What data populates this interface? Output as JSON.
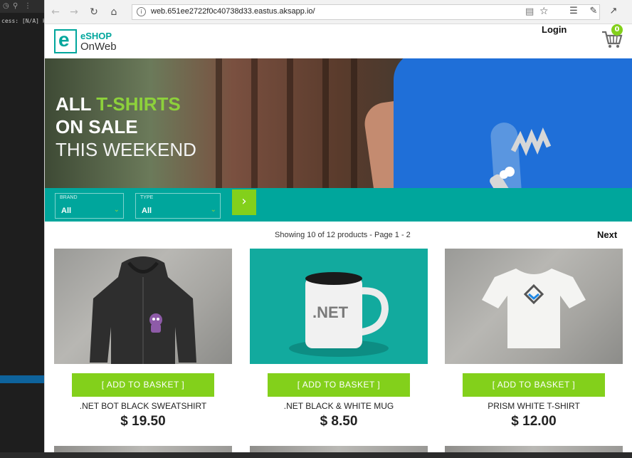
{
  "editor": {
    "access_text": "cess:  [N/A] ku",
    "tool_glyphs": [
      "◷",
      "⚲",
      "⋮"
    ]
  },
  "browser": {
    "url": "web.651ee2722f0c40738d33.eastus.aksapp.io/",
    "icons": {
      "back": "back-arrow-icon",
      "forward": "forward-arrow-icon",
      "refresh": "refresh-icon",
      "home": "home-icon",
      "info": "info-icon",
      "reader": "reading-view-icon",
      "favorite": "star-icon",
      "favorites_hub": "favorites-hub-icon",
      "notes": "web-note-icon",
      "share": "share-icon",
      "more": "more-icon"
    }
  },
  "header": {
    "brand_line1": "eSHOP",
    "brand_line2": "OnWeb",
    "logo_letter": "e",
    "login_label": "Login",
    "cart_count": "0"
  },
  "hero": {
    "line1_white": "ALL ",
    "line1_green": "T-SHIRTS",
    "line2": "ON SALE",
    "line3": "THIS WEEKEND"
  },
  "filters": {
    "brand": {
      "label": "BRAND",
      "value": "All"
    },
    "type": {
      "label": "TYPE",
      "value": "All"
    },
    "go_icon": "chevron-right-icon"
  },
  "pager": {
    "info": "Showing 10 of 12 products - Page 1 - 2",
    "next_label": "Next"
  },
  "products": [
    {
      "name": ".NET BOT BLACK SWEATSHIRT",
      "price": "$ 19.50",
      "button": "[ ADD TO BASKET ]"
    },
    {
      "name": ".NET BLACK & WHITE MUG",
      "price": "$ 8.50",
      "button": "[ ADD TO BASKET ]",
      "mug_text": ".NET"
    },
    {
      "name": "PRISM WHITE T-SHIRT",
      "price": "$ 12.00",
      "button": "[ ADD TO BASKET ]"
    }
  ],
  "colors": {
    "teal": "#00a69c",
    "green": "#83d01b"
  }
}
